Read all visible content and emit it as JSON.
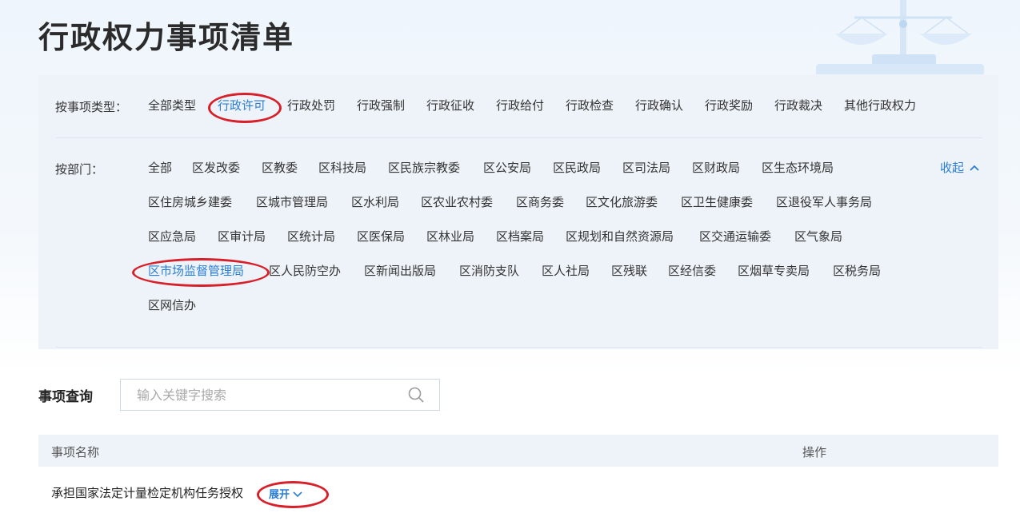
{
  "page": {
    "title": "行政权力事项清单"
  },
  "filters": {
    "type_label": "按事项类型：",
    "types": [
      {
        "label": "全部类型",
        "active": false
      },
      {
        "label": "行政许可",
        "active": true
      },
      {
        "label": "行政处罚",
        "active": false
      },
      {
        "label": "行政强制",
        "active": false
      },
      {
        "label": "行政征收",
        "active": false
      },
      {
        "label": "行政给付",
        "active": false
      },
      {
        "label": "行政检查",
        "active": false
      },
      {
        "label": "行政确认",
        "active": false
      },
      {
        "label": "行政奖励",
        "active": false
      },
      {
        "label": "行政裁决",
        "active": false
      },
      {
        "label": "其他行政权力",
        "active": false
      }
    ],
    "dept_label": "按部门：",
    "collapse_label": "收起",
    "dept_rows": [
      [
        "全部",
        "区发改委",
        "区教委",
        "区科技局",
        "区民族宗教委",
        "区公安局",
        "区民政局",
        "区司法局",
        "区财政局",
        "区生态环境局"
      ],
      [
        "区住房城乡建委",
        "区城市管理局",
        "区水利局",
        "区农业农村委",
        "区商务委",
        "区文化旅游委",
        "区卫生健康委",
        "区退役军人事务局"
      ],
      [
        "区应急局",
        "区审计局",
        "区统计局",
        "区医保局",
        "区林业局",
        "区档案局",
        "区规划和自然资源局",
        "区交通运输委",
        "区气象局"
      ],
      [
        "区市场监督管理局",
        "区人民防空办",
        "区新闻出版局",
        "区消防支队",
        "区人社局",
        "区残联",
        "区经信委",
        "区烟草专卖局",
        "区税务局"
      ],
      [
        "区网信办"
      ]
    ],
    "active_dept": "区市场监督管理局"
  },
  "search": {
    "label": "事项查询",
    "placeholder": "输入关键字搜索",
    "value": ""
  },
  "table": {
    "headers": {
      "name": "事项名称",
      "op": "操作"
    },
    "rows": [
      {
        "name": "承担国家法定计量检定机构任务授权",
        "expand_label": "展开"
      }
    ]
  },
  "colors": {
    "accent": "#2a7dd4",
    "highlight_ring": "#d8202a",
    "panel": "#eef3f9"
  }
}
